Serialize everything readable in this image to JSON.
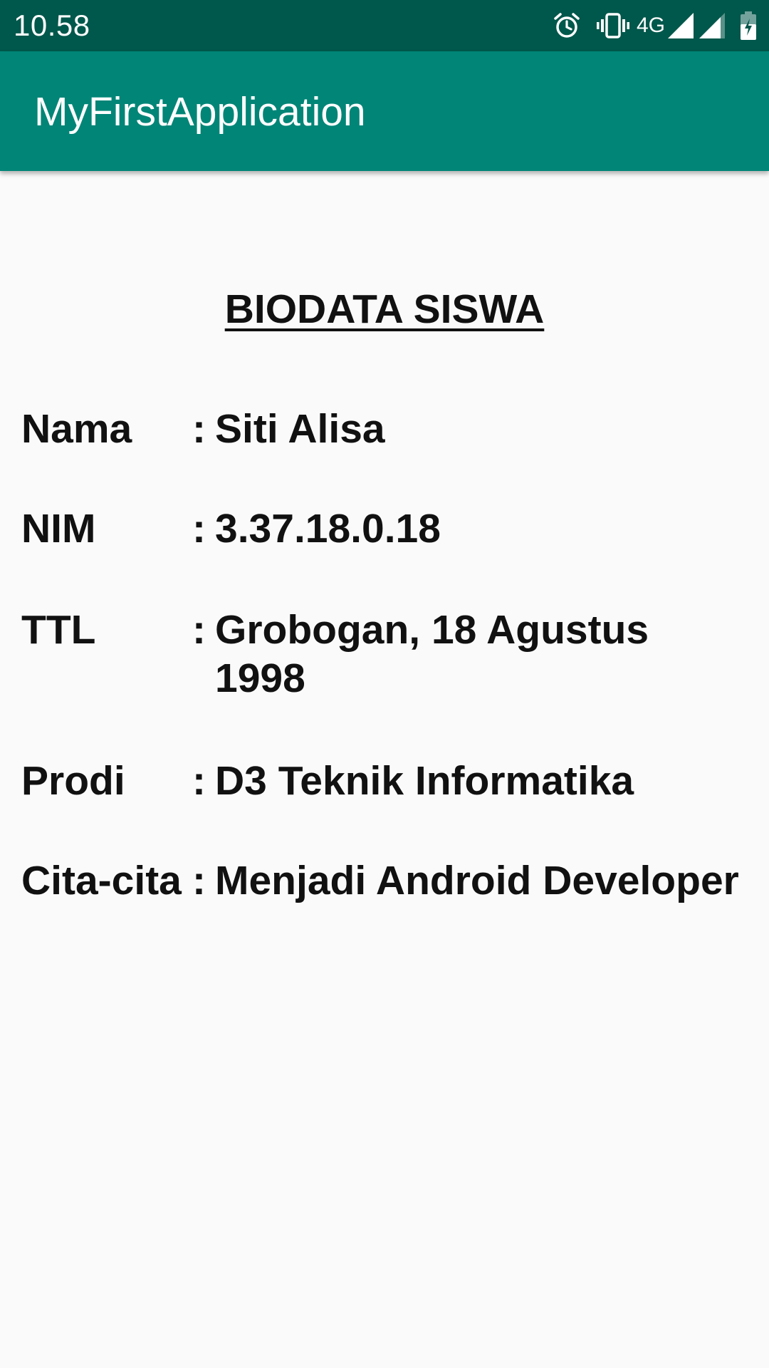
{
  "status_bar": {
    "time": "10.58",
    "network": "4G",
    "icons": [
      "alarm-icon",
      "vibrate-icon",
      "signal-icon",
      "signal-icon",
      "battery-charging-icon"
    ]
  },
  "app_bar": {
    "title": "MyFirstApplication"
  },
  "content": {
    "heading": "BIODATA SISWA",
    "separator": ":",
    "rows": [
      {
        "label": "Nama",
        "value": "Siti Alisa"
      },
      {
        "label": "NIM",
        "value": "3.37.18.0.18"
      },
      {
        "label": "TTL",
        "value": "Grobogan, 18 Agustus 1998"
      },
      {
        "label": "Prodi",
        "value": "D3 Teknik Informatika"
      },
      {
        "label": "Cita-cita",
        "value": "Menjadi Android Developer"
      }
    ]
  },
  "colors": {
    "status_bar": "#00574B",
    "app_bar": "#008577",
    "background": "#FAFAFA",
    "text": "#111111"
  }
}
